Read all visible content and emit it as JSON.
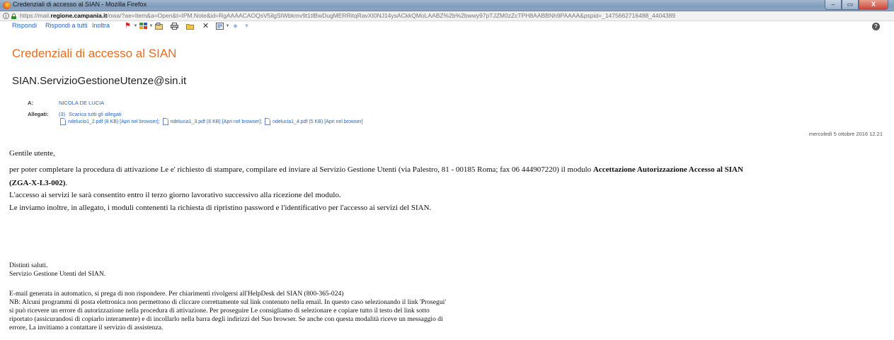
{
  "window": {
    "title": "Credenziali di accesso al SIAN - Mozilla Firefox",
    "controls": [
      "–",
      "▭",
      "X"
    ]
  },
  "address_bar": {
    "url_prefix": "https://mail.",
    "url_domain": "regione.campania.it",
    "url_rest": "/owa/?ae=Item&a=Open&t=IPM.Note&id=RgAAAACAOQsV5ilgSIWbkmv9t1tlBwDugMERRitqRavXt0NJ14ysACkkQMoLAABZ%2b%2bwwy97pTJZM0zZcTPH8AABBNh9PAAAA&pspid=_1475662716488_4404389"
  },
  "toolbar": {
    "reply": "Rispondi",
    "reply_all": "Rispondi a tutti",
    "forward": "Inoltra",
    "icons": [
      "flag-icon",
      "categories-icon",
      "move-icon",
      "print-icon",
      "folder-icon",
      "delete-icon",
      "junk-icon",
      "previous-icon",
      "next-icon",
      "help-icon"
    ]
  },
  "message": {
    "subject": "Credenziali di accesso al SIAN",
    "sender": "SIAN.ServizioGestioneUtenze@sin.it",
    "to_label": "A:",
    "to_value": "NICOLA DE LUCIA",
    "attachments_label": "Allegati:",
    "attachments_count": "(3)",
    "download_all": "Scarica tutti gli allegati",
    "attachments": [
      {
        "name": "ndelucia1_2.pdf (8 KB)",
        "open": "[Apri nel browser]"
      },
      {
        "name": "ndelucia1_3.pdf (6 KB)",
        "open": "[Apri nel browser]"
      },
      {
        "name": "ndelucia1_4.pdf (5 KB)",
        "open": "[Apri nel browser]"
      }
    ],
    "date": "mercoledì 5 ottobre 2016 12.21"
  },
  "body": {
    "greeting": "Gentile utente,",
    "p1_text": "per poter completare la procedura di attivazione Le e' richiesto di stampare, compilare ed inviare al Servizio Gestione Utenti (via Palestro, 81 - 00185 Roma; fax 06 444907220) il modulo ",
    "p1_bold": "Accettazione Autorizzazione Accesso al SIAN",
    "p1_code": "(ZGA-X-L3-002)",
    "p1_end": ".",
    "p2": "L'accesso ai servizi le sarà consentito entro il terzo giorno lavorativo successivo alla ricezione del modulo.",
    "p3": "Le inviamo inoltre, in allegato, i moduli contenenti la richiesta di ripristino password e l'identificativo per l'accesso ai servizi del SIAN.",
    "closing1": "Distinti saluti.",
    "closing2": "Servizio Gestione Utenti del SIAN.",
    "note1": "E-mail generata in automatico, si prega di non rispondere. Per chiarimenti rivolgersi all'HelpDesk del SIAN (800-365-024)",
    "note2": "NB: Alcuni programmi di posta elettronica non permettono di cliccare correttamente sul link contenuto nella email. In questo caso selezionando il link 'Prosegui'",
    "note3": "si può ricevere un errore di autorizzazione nella procedura di attivazione. Per proseguire Le consigliamo di selezionare e copiare tutto il testo del link sotto",
    "note4": "riportato (assicurandosi di copiarlo interamente) e di incollarlo nella barra degli indirizzi del Suo browser. Se anche con questa modalità riceve un messaggio di",
    "note5": "errore, La invitiamo a contattare il servizio di assistenza."
  }
}
